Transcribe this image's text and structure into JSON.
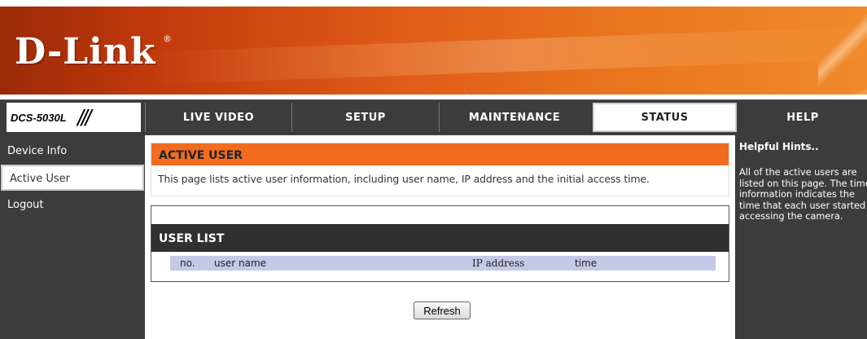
{
  "banner": {
    "logo_text": "D-Link",
    "logo_mark": "®"
  },
  "header": {
    "model": "DCS-5030L",
    "model_slashes": "///"
  },
  "nav": {
    "tabs": [
      {
        "label": "LIVE VIDEO",
        "active": false
      },
      {
        "label": "SETUP",
        "active": false
      },
      {
        "label": "MAINTENANCE",
        "active": false
      },
      {
        "label": "STATUS",
        "active": true
      },
      {
        "label": "HELP",
        "active": false
      }
    ]
  },
  "sidebar": {
    "items": [
      {
        "label": "Device Info",
        "active": false
      },
      {
        "label": "Active User",
        "active": true
      },
      {
        "label": "Logout",
        "active": false
      }
    ]
  },
  "main": {
    "active_user_title": "ACTIVE USER",
    "active_user_desc": "This page lists active user information, including user name, IP address and the initial access time.",
    "user_list_title": "USER LIST",
    "columns": {
      "no": "no.",
      "user_name": "user name",
      "ip_address": "IP address",
      "time": "time"
    },
    "refresh_label": "Refresh"
  },
  "hints": {
    "title": "Helpful Hints..",
    "text": "All of the active users are listed on this page. The time information indicates the time that each user started accessing the camera."
  },
  "colors": {
    "accent_orange": "#f26c20",
    "nav_dark": "#3c3c3c",
    "column_header_bg": "#c3c9e6"
  }
}
